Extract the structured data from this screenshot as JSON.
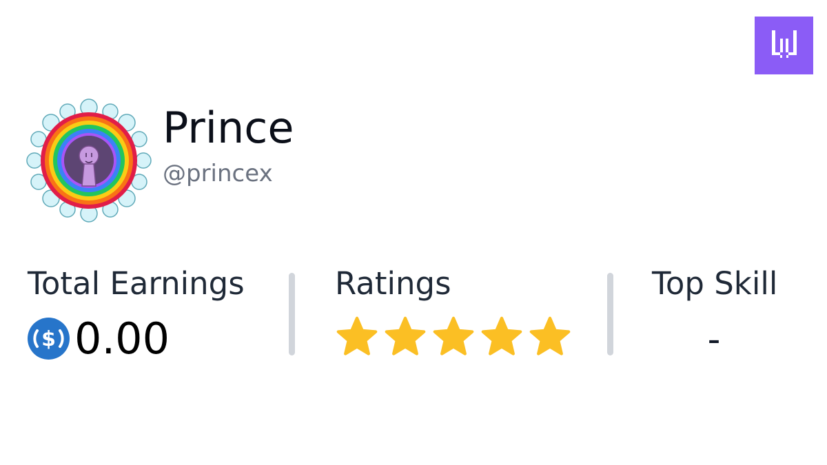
{
  "brand": {
    "logo_icon": "workmate-w-logo-icon",
    "color": "#8b5cf6"
  },
  "profile": {
    "name": "Prince",
    "handle": "@princex",
    "avatar_icon": "rainbow-pixel-avatar"
  },
  "stats": {
    "earnings": {
      "label": "Total Earnings",
      "value": "0.00",
      "currency_icon": "usdc-coin-icon",
      "currency_color": "#2775ca"
    },
    "ratings": {
      "label": "Ratings",
      "stars_filled": 5,
      "stars_total": 5,
      "star_color": "#fbbf24"
    },
    "top_skill": {
      "label": "Top Skill",
      "value": "-"
    }
  }
}
